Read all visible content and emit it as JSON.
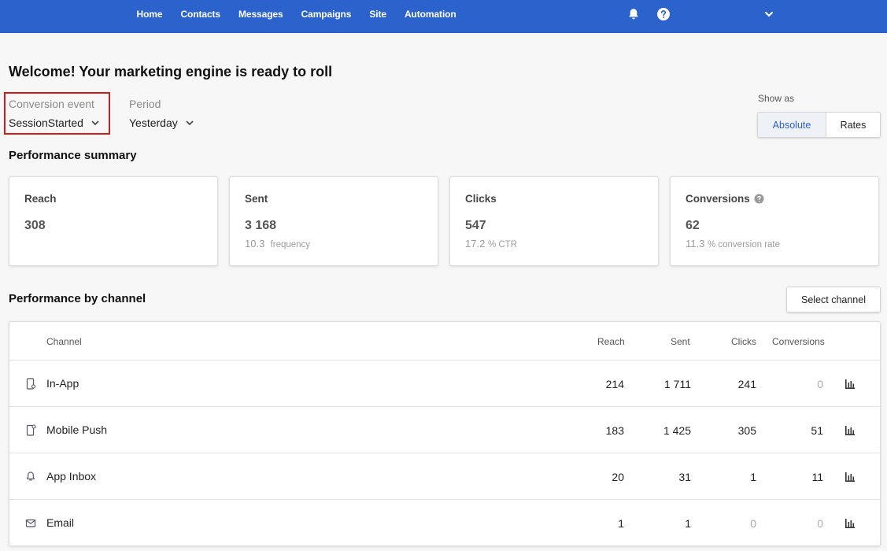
{
  "nav": {
    "items": [
      "Home",
      "Contacts",
      "Messages",
      "Campaigns",
      "Site",
      "Automation"
    ]
  },
  "header": {
    "icons": [
      "bell-icon",
      "help-icon",
      "chevron-down-icon"
    ]
  },
  "welcome": "Welcome! Your marketing engine is ready to roll",
  "filters": {
    "conversion_label": "Conversion event",
    "conversion_value": "SessionStarted",
    "period_label": "Period",
    "period_value": "Yesterday"
  },
  "show_as": {
    "label": "Show as",
    "absolute": "Absolute",
    "rates": "Rates",
    "selected": "Absolute"
  },
  "summary": {
    "title": "Performance summary",
    "cards": [
      {
        "title": "Reach",
        "value": "308",
        "sub_value": "",
        "sub_label": ""
      },
      {
        "title": "Sent",
        "value": "3 168",
        "sub_value": "10.3",
        "sub_label": "frequency"
      },
      {
        "title": "Clicks",
        "value": "547",
        "sub_value": "17.2",
        "sub_label": "% CTR"
      },
      {
        "title": "Conversions",
        "value": "62",
        "sub_value": "11.3",
        "sub_label": "% conversion rate"
      }
    ]
  },
  "channels": {
    "title": "Performance by channel",
    "select_label": "Select channel",
    "columns": {
      "channel": "Channel",
      "reach": "Reach",
      "sent": "Sent",
      "clicks": "Clicks",
      "conversions": "Conversions"
    },
    "rows": [
      {
        "name": "In-App",
        "icon": "in-app-icon",
        "reach": "214",
        "sent": "1 711",
        "clicks": "241",
        "conversions": "0"
      },
      {
        "name": "Mobile Push",
        "icon": "mobile-push-icon",
        "reach": "183",
        "sent": "1 425",
        "clicks": "305",
        "conversions": "51"
      },
      {
        "name": "App Inbox",
        "icon": "bell-icon",
        "reach": "20",
        "sent": "31",
        "clicks": "1",
        "conversions": "11"
      },
      {
        "name": "Email",
        "icon": "email-icon",
        "reach": "1",
        "sent": "1",
        "clicks": "0",
        "conversions": "0"
      }
    ]
  },
  "colors": {
    "brand": "#2c62cc",
    "highlight": "#d11b1b"
  }
}
